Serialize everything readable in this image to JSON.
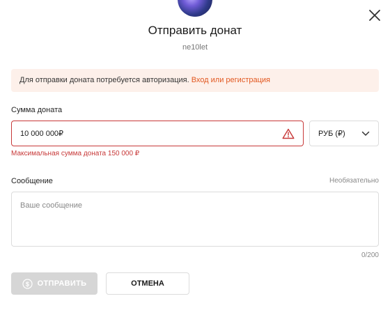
{
  "modal": {
    "title": "Отправить донат",
    "recipient": "ne10let",
    "close_icon": "close-icon",
    "avatar_icon": "avatar"
  },
  "alert": {
    "text": "Для отправки доната потребуется авторизация.",
    "link": "Вход или регистрация",
    "color_bg": "#fdf0ea",
    "color_link": "#e2571f"
  },
  "amount": {
    "label": "Сумма доната",
    "value": "10 000 000₽",
    "error": "Максимальная сумма доната 150 000 ₽",
    "error_color": "#c73838",
    "warning_icon": "warning-triangle-icon"
  },
  "currency": {
    "selected": "РУБ (₽)",
    "icon": "chevron-down-icon"
  },
  "message": {
    "label": "Сообщение",
    "optional": "Необязательно",
    "placeholder": "Ваше сообщение",
    "counter": "0/200"
  },
  "actions": {
    "send": "ОТПРАВИТЬ",
    "send_icon": "coin-icon",
    "cancel": "ОТМЕНА"
  }
}
